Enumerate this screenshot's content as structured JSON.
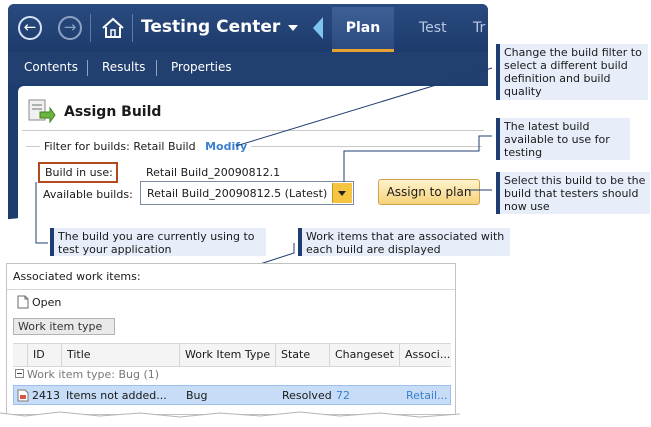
{
  "app": {
    "title": "Testing Center",
    "tabs": [
      {
        "label": "Plan",
        "active": true
      },
      {
        "label": "Test"
      },
      {
        "label": "Tr"
      }
    ],
    "subnav": [
      "Contents",
      "Results",
      "Properties"
    ]
  },
  "assign_build": {
    "title": "Assign Build",
    "filter_label": "Filter for builds:",
    "filter_value": "Retail Build",
    "modify_label": "Modify",
    "build_in_use_label": "Build in use:",
    "build_in_use_value": "Retail Build_20090812.1",
    "available_builds_label": "Available builds:",
    "available_builds_selected": "Retail Build_20090812.5 (Latest)",
    "assign_button": "Assign to plan"
  },
  "annotations": {
    "filter": [
      "Change the build filter to",
      "select a different build",
      "definition and build",
      "quality"
    ],
    "latest": [
      "The latest build",
      "available to use for",
      "testing"
    ],
    "select": [
      "Select this build to be the",
      "build that testers should",
      "now use"
    ],
    "current": [
      "The build you are currently using to",
      "test your application"
    ],
    "workitems": [
      "Work items that are associated with",
      "each build are displayed"
    ]
  },
  "work_items": {
    "title": "Associated work items:",
    "open_label": "Open",
    "group_by": "Work item type",
    "columns": [
      "ID",
      "Title",
      "Work Item Type",
      "State",
      "Changeset",
      "Associ..."
    ],
    "group_row": "Work item type: Bug (1)",
    "rows": [
      {
        "id": "2413",
        "title": "Items not added...",
        "type": "Bug",
        "state": "Resolved",
        "changeset": "72",
        "assoc": "Retail..."
      }
    ]
  },
  "colors": {
    "header": "#1e3d6f",
    "accent_tab": "#e8a230",
    "highlight_box": "#b24a1e",
    "note_bg": "#e7eef9",
    "selected_row": "#c7dcf6",
    "link": "#3a7fd0"
  },
  "icons": [
    "back-icon",
    "forward-icon",
    "home-icon",
    "dropdown-icon",
    "assign-build-icon",
    "open-icon",
    "bug-icon"
  ]
}
